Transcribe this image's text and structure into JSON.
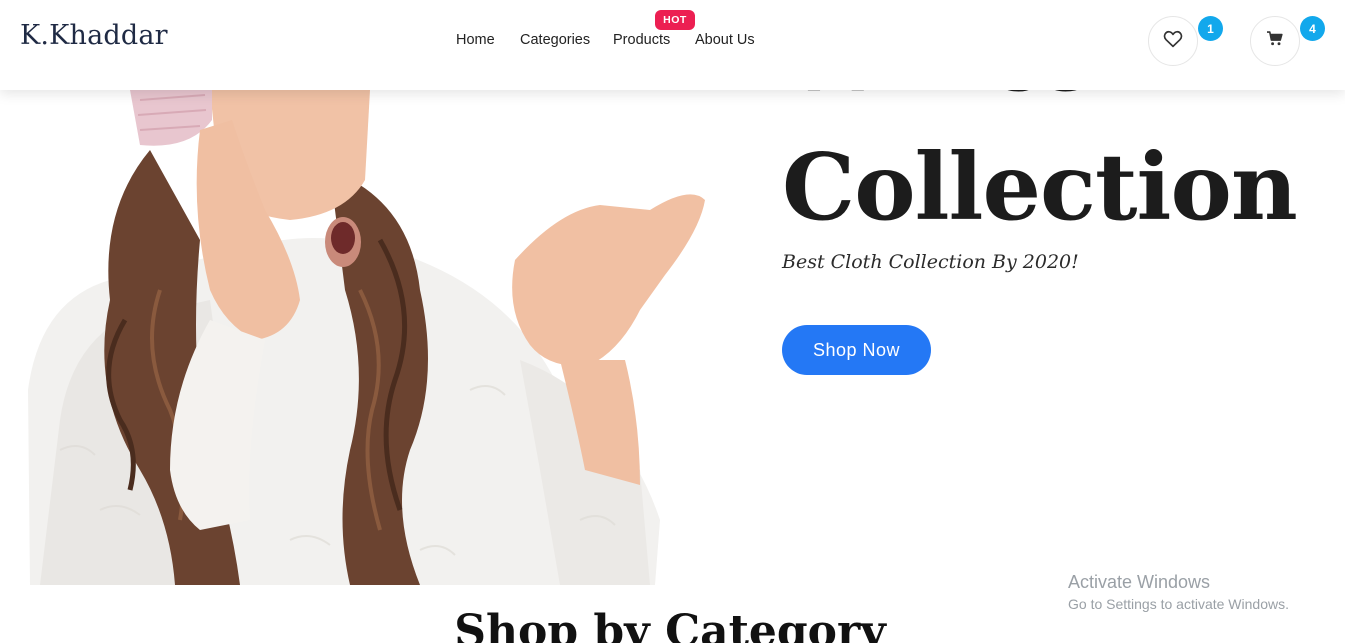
{
  "header": {
    "logo": "K.Khaddar",
    "nav": [
      {
        "label": "Home"
      },
      {
        "label": "Categories"
      },
      {
        "label": "Products"
      },
      {
        "label": "About Us"
      }
    ],
    "hot_badge": "HOT",
    "wishlist": {
      "icon": "heart-icon",
      "count": "1"
    },
    "cart": {
      "icon": "cart-icon",
      "count": "4"
    }
  },
  "hero": {
    "title_line1": "Winter",
    "title_line2": "Collection",
    "subtitle": "Best Cloth Collection By 2020!",
    "button_label": "Shop Now",
    "image": "woman-in-white-sweater-and-pink-beanie-pointing-thumb"
  },
  "section": {
    "title": "Shop by Category"
  },
  "os_watermark": {
    "title": "Activate Windows",
    "subtitle": "Go to Settings to activate Windows."
  },
  "colors": {
    "accent": "#2478f5",
    "hot_badge": "#ec1f52",
    "count_badge": "#12a8ec",
    "text_dark": "#1c1c1c"
  }
}
